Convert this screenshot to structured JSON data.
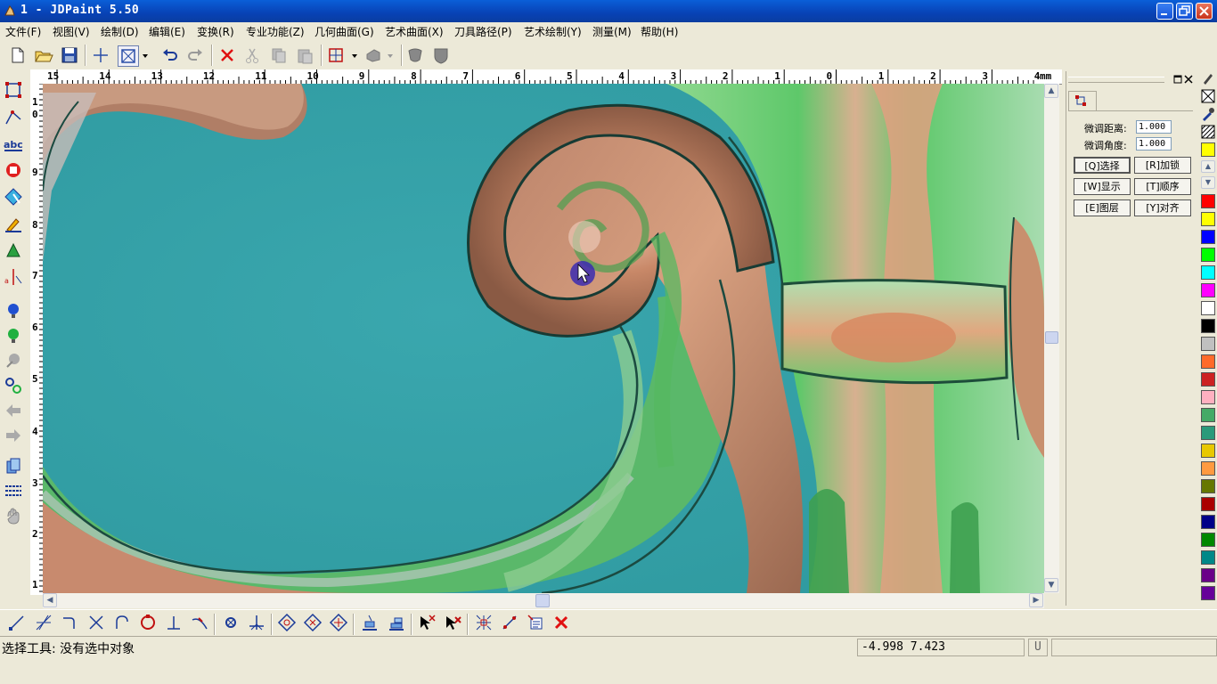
{
  "window": {
    "title": "1 - JDPaint 5.50"
  },
  "menu": [
    "文件(F)",
    "视图(V)",
    "绘制(D)",
    "编辑(E)",
    "变换(R)",
    "专业功能(Z)",
    "几何曲面(G)",
    "艺术曲面(X)",
    "刀具路径(P)",
    "艺术绘制(Y)",
    "测量(M)",
    "帮助(H)"
  ],
  "ruler": {
    "unit": "mm",
    "h_ticks": [
      "15",
      "14",
      "13",
      "12",
      "11",
      "10",
      "9",
      "8",
      "7",
      "6",
      "5",
      "4",
      "3",
      "2",
      "1",
      "0",
      "1",
      "2",
      "3",
      "4"
    ],
    "v_ticks": [
      "1",
      "0",
      "9",
      "8",
      "7",
      "6",
      "5",
      "4",
      "3",
      "2",
      "1"
    ]
  },
  "panel": {
    "distance_label": "微调距离:",
    "distance_value": "1.000",
    "angle_label": "微调角度:",
    "angle_value": "1.000",
    "buttons": [
      "[Q]选择",
      "[R]加锁",
      "[W]显示",
      "[T]顺序",
      "[E]图层",
      "[Y]对齐"
    ]
  },
  "palette": {
    "colors": [
      "#ff0000",
      "#ffff00",
      "#0000ff",
      "#00ff00",
      "#00ffff",
      "#ff00ff",
      "#ffffff",
      "#000000",
      "#c0c0c0",
      "#ff6a2a",
      "#cc2222",
      "#ffb0c0",
      "#44aa66",
      "#2a9a7a",
      "#e8c800",
      "#ff9a40",
      "#667700",
      "#aa0000",
      "#000088",
      "#008800",
      "#008888",
      "#6a0088",
      "#660099"
    ]
  },
  "status": {
    "message": "选择工具: 没有选中对象",
    "coords": "-4.998 7.423",
    "mode": "U"
  }
}
